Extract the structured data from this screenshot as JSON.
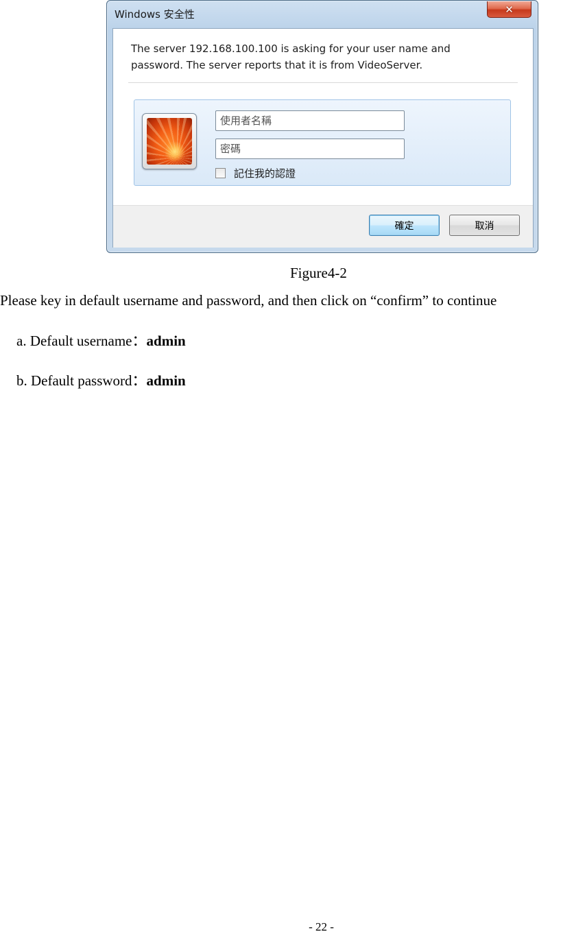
{
  "dialog": {
    "title": "Windows 安全性",
    "close_symbol": "✕",
    "message": "The server 192.168.100.100 is asking for your user name and password. The server reports that it is from VideoServer.",
    "username_placeholder": "使用者名稱",
    "password_placeholder": "密碼",
    "remember_label": "記住我的認證",
    "remember_checked": false,
    "ok_label": "確定",
    "cancel_label": "取消",
    "avatar_icon": "user-tile-flower-icon"
  },
  "document": {
    "caption": "Figure4-2",
    "instruction": "Please key in default username and password, and then click on “confirm” to continue",
    "items": [
      {
        "label": "a. Default username：",
        "value": "admin"
      },
      {
        "label": "b. Default password：",
        "value": "admin"
      }
    ],
    "page_number": "- 22 -"
  }
}
